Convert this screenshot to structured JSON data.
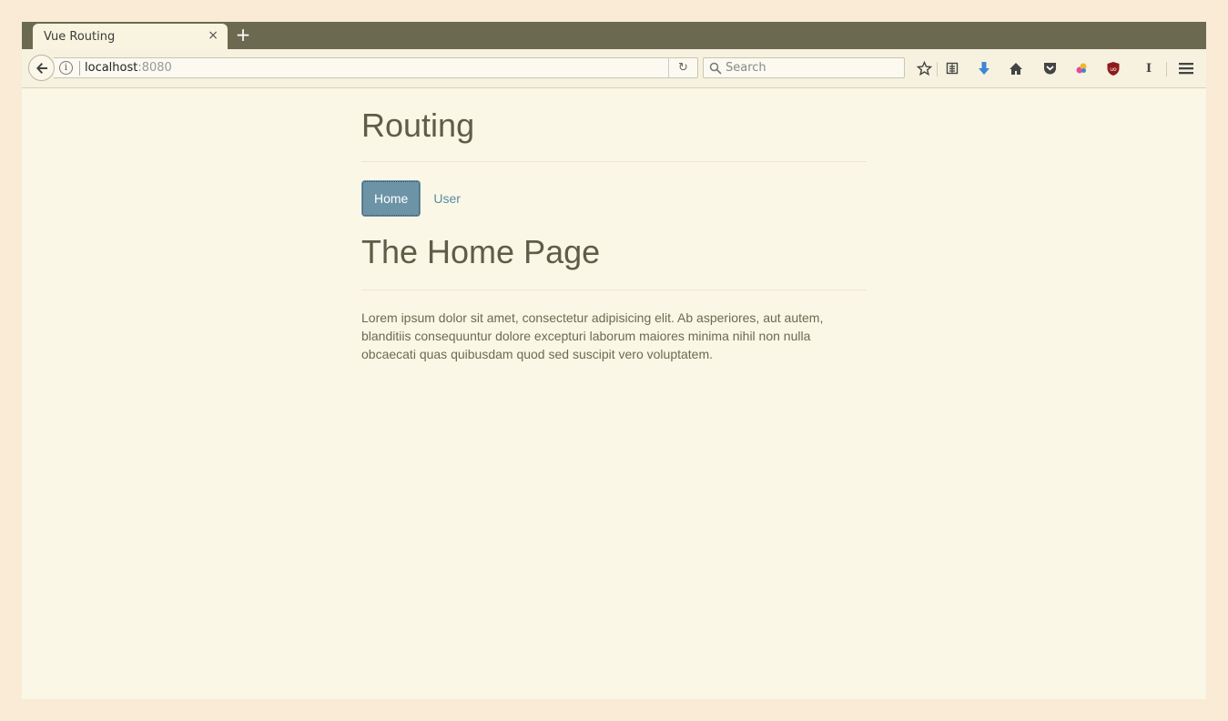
{
  "browser": {
    "tab_title": "Vue Routing",
    "tab_close": "×",
    "new_tab": "+",
    "url_host": "localhost",
    "url_port": ":8080",
    "search_placeholder": "Search",
    "reload_glyph": "C",
    "toolbar_icons": [
      "star-icon",
      "reading-list-icon",
      "download-icon",
      "home-icon",
      "pocket-icon",
      "color-picker-icon",
      "ublock-icon",
      "i-icon",
      "menu-icon"
    ]
  },
  "page": {
    "title": "Routing",
    "nav": [
      {
        "label": "Home",
        "active": true
      },
      {
        "label": "User",
        "active": false
      }
    ],
    "heading": "The Home Page",
    "body": "Lorem ipsum dolor sit amet, consectetur adipisicing elit. Ab asperiores, aut autem, blanditiis consequuntur dolore excepturi laborum maiores minima nihil non nulla obcaecati quas quibusdam quod sed suscipit vero voluptatem."
  },
  "colors": {
    "accent": "#6d94a6",
    "link": "#5a8ba1",
    "heading": "#5d5e47",
    "tabstrip": "#6b6a51",
    "page_bg": "#fbf7e6"
  }
}
